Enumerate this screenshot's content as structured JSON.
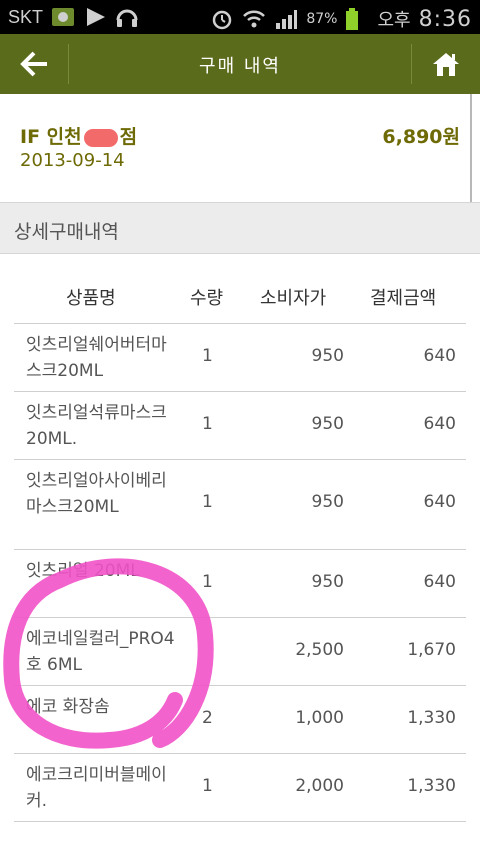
{
  "status_bar": {
    "carrier": "SKT",
    "battery": "87%",
    "ampm": "오후",
    "time": "8:36"
  },
  "header": {
    "title": "구매 내역",
    "back_icon": "arrow-left-icon",
    "home_icon": "home-icon"
  },
  "summary": {
    "store_name": "IF 인천",
    "store_suffix": "점",
    "date": "2013-09-14",
    "total": "6,890원"
  },
  "section": {
    "title": "상세구매내역"
  },
  "table": {
    "headers": [
      "상품명",
      "수량",
      "소비자가",
      "결제금액"
    ],
    "rows": [
      {
        "name": "잇츠리얼쉐어버터마스크20ML",
        "qty": "1",
        "price": "950",
        "pay": "640"
      },
      {
        "name": "잇츠리얼석류마스크20ML.",
        "qty": "1",
        "price": "950",
        "pay": "640"
      },
      {
        "name": "잇츠리얼아사이베리마스크20ML",
        "qty": "1",
        "price": "950",
        "pay": "640"
      },
      {
        "name": "잇츠리얼 20ML",
        "qty": "1",
        "price": "950",
        "pay": "640"
      },
      {
        "name": "에코네일컬러_PRO4호 6ML",
        "qty": "",
        "price": "2,500",
        "pay": "1,670"
      },
      {
        "name": "에코 화장솜",
        "qty": "2",
        "price": "1,000",
        "pay": "1,330"
      },
      {
        "name": "에코크리미버블메이커.",
        "qty": "1",
        "price": "2,000",
        "pay": "1,330"
      }
    ]
  },
  "colors": {
    "header_bg": "#5b6b1c",
    "accent_text": "#6e6a06",
    "annotation": "#f252c8"
  }
}
